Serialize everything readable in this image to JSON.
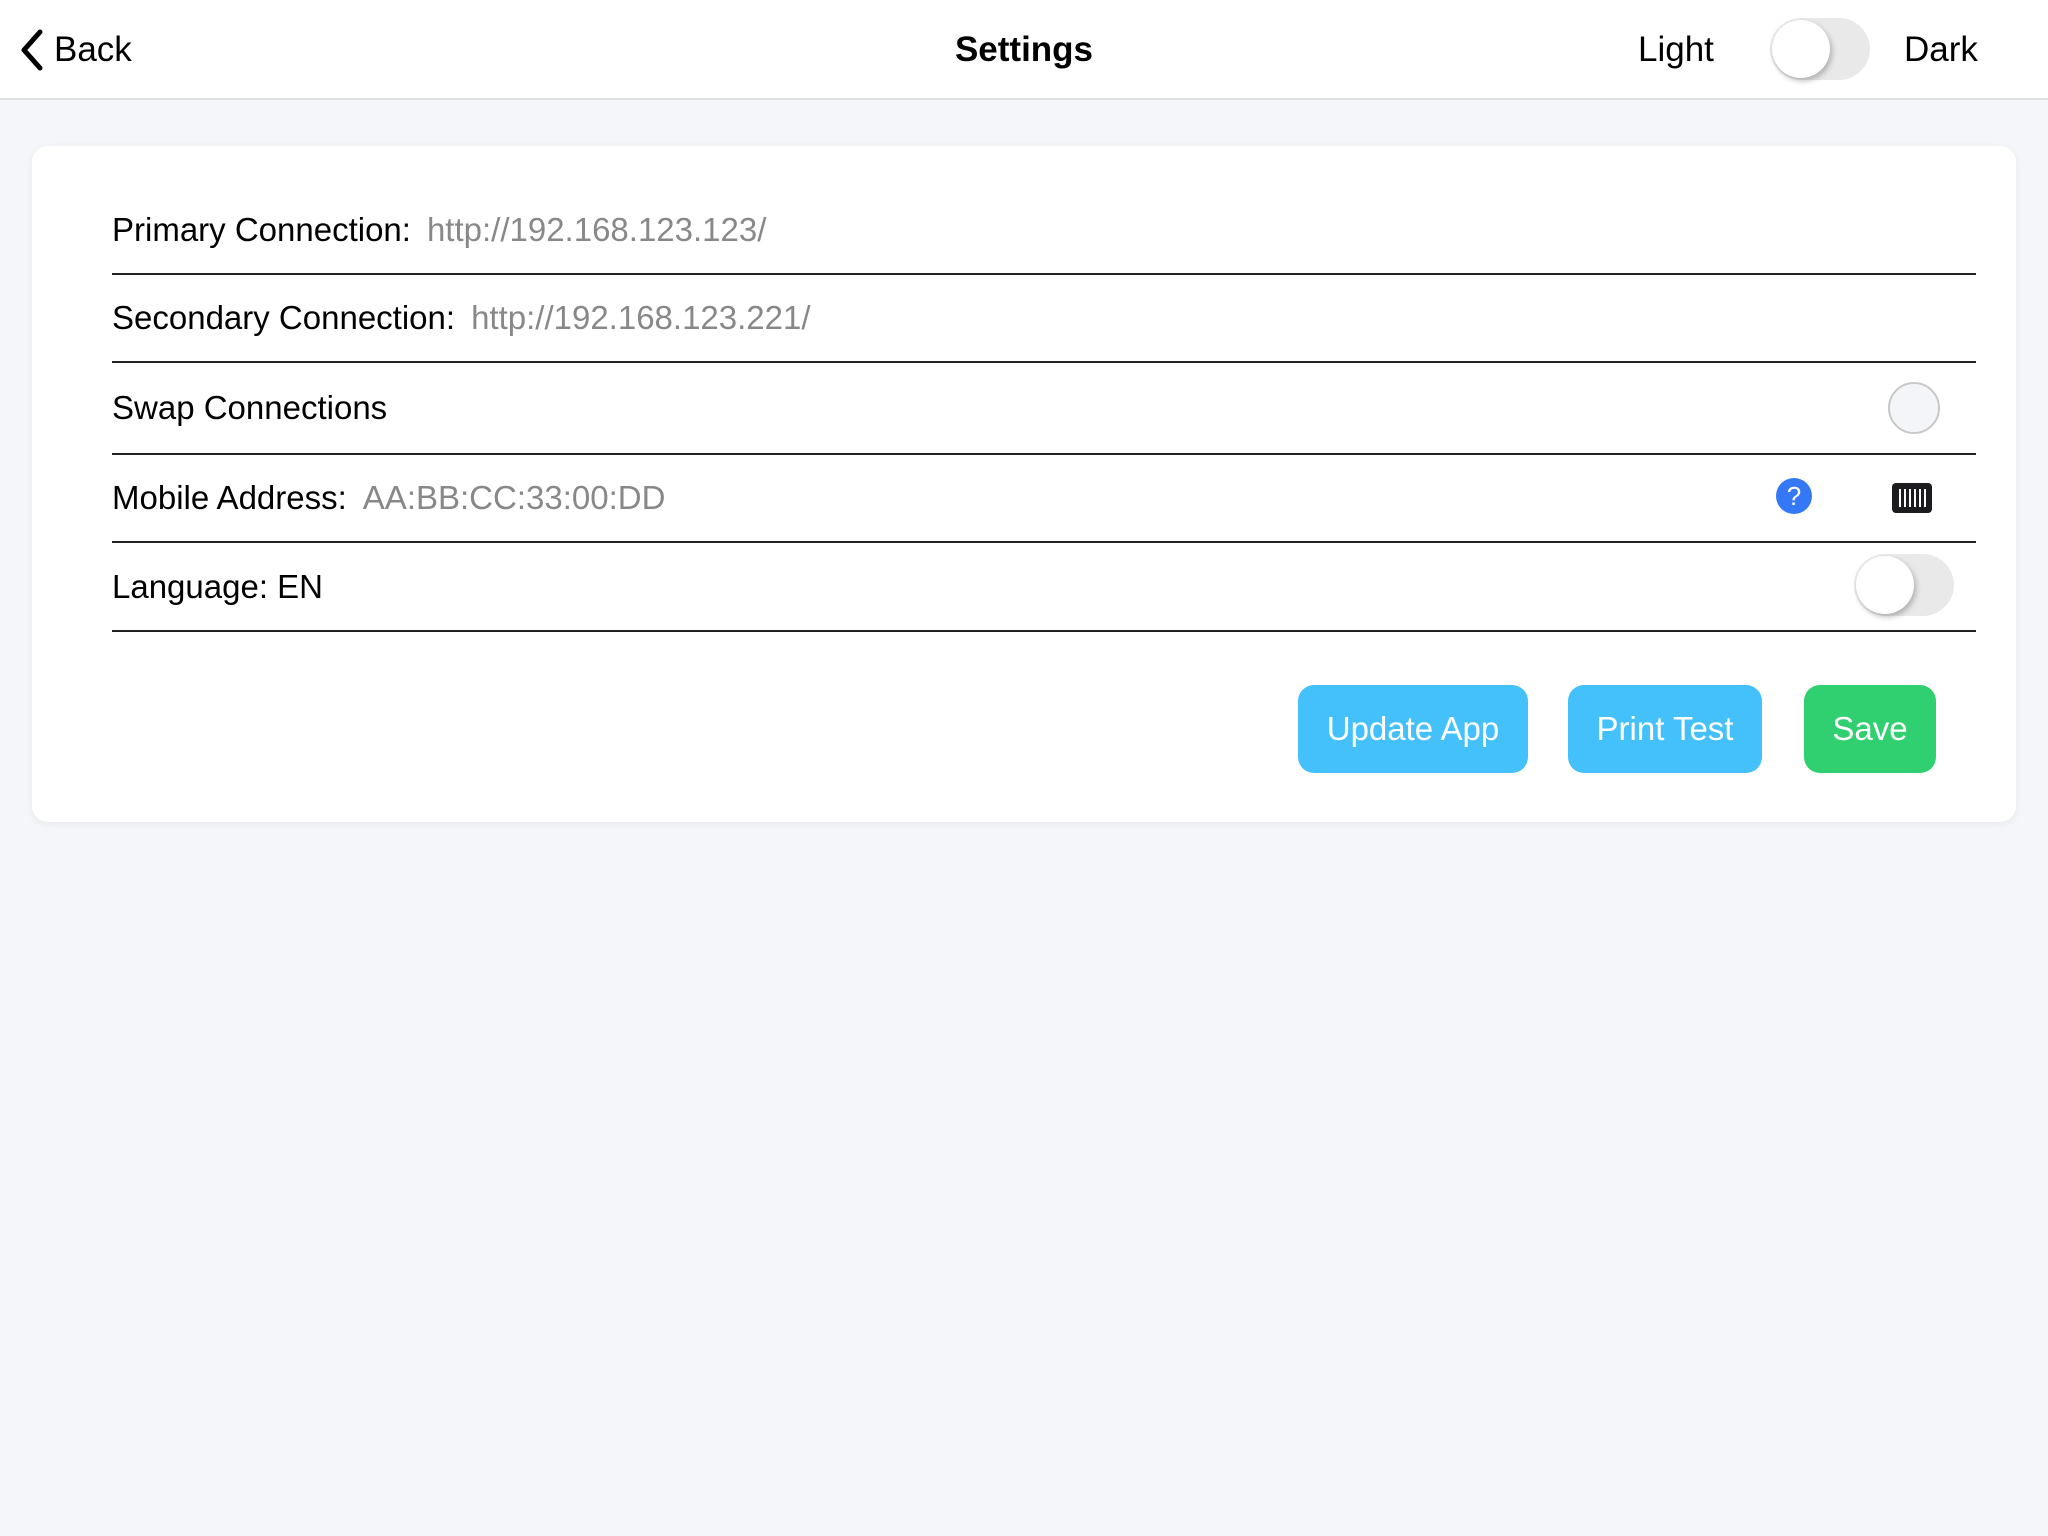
{
  "header": {
    "back_label": "Back",
    "title": "Settings",
    "theme_light_label": "Light",
    "theme_dark_label": "Dark",
    "theme_dark_enabled": false
  },
  "settings": {
    "primary_connection": {
      "label": "Primary Connection:",
      "value": "http://192.168.123.123/"
    },
    "secondary_connection": {
      "label": "Secondary Connection:",
      "value": "http://192.168.123.221/"
    },
    "swap_connections": {
      "label": "Swap Connections",
      "checked": false
    },
    "mobile_address": {
      "label": "Mobile Address:",
      "value": "AA:BB:CC:33:00:DD",
      "help_icon": "question-circle-icon",
      "scan_icon": "barcode-scan-icon"
    },
    "language": {
      "label": "Language: EN",
      "enabled": false
    }
  },
  "actions": {
    "update_app": "Update App",
    "print_test": "Print Test",
    "save": "Save"
  },
  "colors": {
    "primary_button": "#44c1fb",
    "save_button": "#30d070",
    "help_icon": "#3478f6"
  }
}
